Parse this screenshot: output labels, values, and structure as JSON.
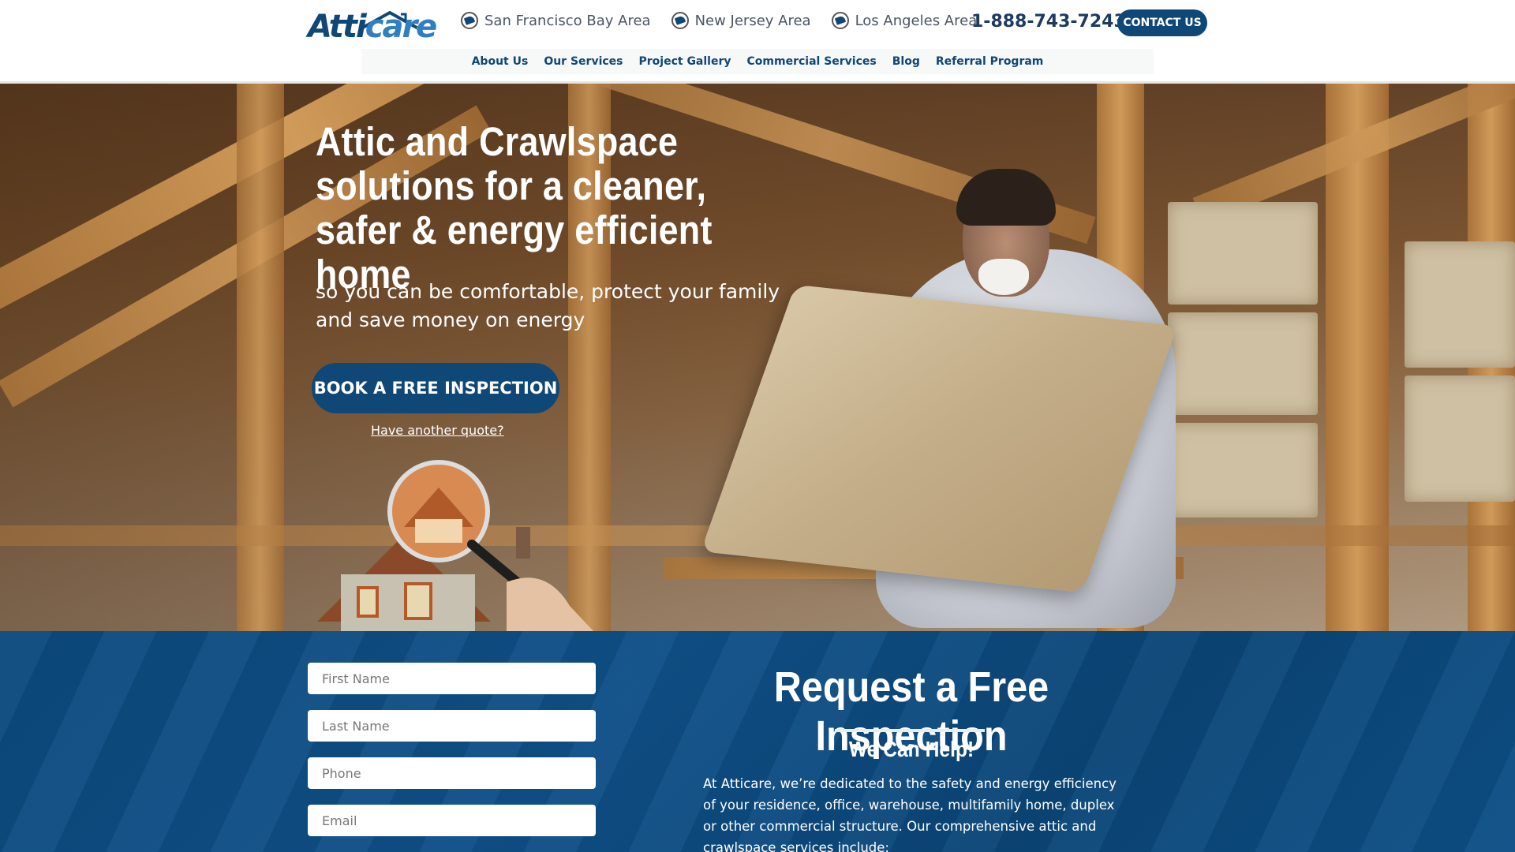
{
  "header": {
    "logo_text_a": "Atti",
    "logo_text_b": "care",
    "areas": [
      "San Francisco Bay Area",
      "New Jersey Area",
      "Los Angeles Area"
    ],
    "phone": "1-888-743-7243",
    "contact_label": "CONTACT US",
    "nav": [
      "About Us",
      "Our Services",
      "Project Gallery",
      "Commercial Services",
      "Blog",
      "Referral Program"
    ]
  },
  "hero": {
    "title": "Attic and Crawlspace solutions for a cleaner, safer & energy efficient home",
    "subtitle": "so you can be comfortable, protect your family and save money on energy",
    "cta_label": "BOOK A FREE INSPECTION",
    "quote_link": "Have another quote?"
  },
  "form": {
    "first_name_placeholder": "First Name",
    "last_name_placeholder": "Last Name",
    "phone_placeholder": "Phone",
    "email_placeholder": "Email"
  },
  "request": {
    "title": "Request a Free Inspection",
    "subtitle": "We Can Help!",
    "body": "At Atticare, we’re dedicated to the safety and energy efficiency of your residence, office, warehouse, multifamily home, duplex or other commercial structure. Our comprehensive attic and crawlspace services include:"
  },
  "colors": {
    "brand_navy": "#0f4777",
    "brand_blue": "#2f7fc1",
    "brand_green": "#6fb43f"
  }
}
